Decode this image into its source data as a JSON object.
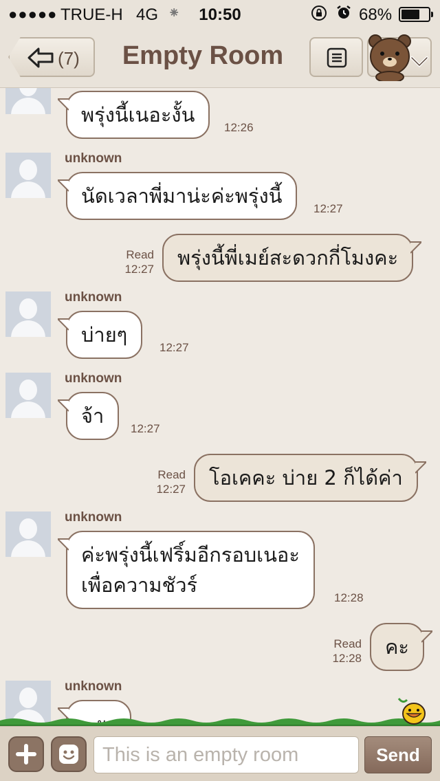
{
  "status_bar": {
    "signal": "●●●●●",
    "carrier": "TRUE-H",
    "network": "4G",
    "activity": "⁕",
    "time": "10:50",
    "lock_glyph": "🔒",
    "alarm_glyph": "⏰",
    "battery_percent": "68%",
    "battery_level": 0.68
  },
  "header": {
    "back_count": "(7)",
    "title": "Empty Room"
  },
  "messages": [
    {
      "direction": "in",
      "sender": "",
      "text": "พรุ่งนี้เนอะงั้น",
      "time": "12:26"
    },
    {
      "direction": "in",
      "sender": "unknown",
      "text": "นัดเวลาพี่มาน่ะค่ะพรุ่งนี้",
      "time": "12:27"
    },
    {
      "direction": "out",
      "read": "Read",
      "text": "พรุ่งนี้พี่เมย์สะดวกกี่โมงคะ",
      "time": "12:27"
    },
    {
      "direction": "in",
      "sender": "unknown",
      "text": "บ่ายๆ",
      "time": "12:27"
    },
    {
      "direction": "in",
      "sender": "unknown",
      "text": "จ้า",
      "time": "12:27"
    },
    {
      "direction": "out",
      "read": "Read",
      "text": "โอเคคะ บ่าย 2 ก็ได้ค่า",
      "time": "12:27"
    },
    {
      "direction": "in",
      "sender": "unknown",
      "text_line1": "ค่ะพรุ่งนี้เฟริ์มอีกรอบเนอะ",
      "text_line2": "เพื่อความชัวร์",
      "time": "12:28"
    },
    {
      "direction": "out",
      "read": "Read",
      "text": "คะ",
      "time": "12:28"
    },
    {
      "direction": "in",
      "sender": "unknown",
      "text": "ครัา",
      "time": ""
    }
  ],
  "input_bar": {
    "placeholder": "This is an empty room",
    "send_label": "Send"
  },
  "colors": {
    "background": "#efeae3",
    "bubble_border": "#8a7162",
    "accent_brown": "#6b5145",
    "incoming_bubble": "#ffffff",
    "outgoing_bubble": "#ece4d8"
  }
}
